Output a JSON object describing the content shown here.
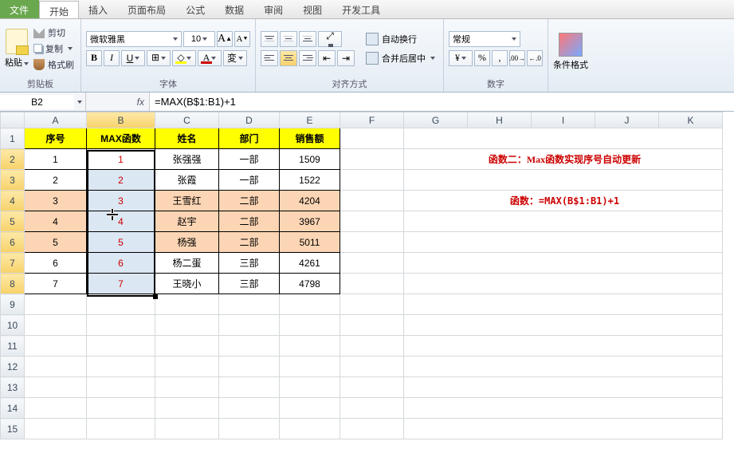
{
  "tabs": {
    "file": "文件",
    "home": "开始",
    "insert": "插入",
    "layout": "页面布局",
    "formulas": "公式",
    "data": "数据",
    "review": "审阅",
    "view": "视图",
    "dev": "开发工具"
  },
  "ribbon": {
    "clipboard": {
      "label": "剪贴板",
      "paste": "粘贴",
      "cut": "剪切",
      "copy": "复制",
      "brush": "格式刷"
    },
    "font": {
      "label": "字体",
      "name": "微软雅黑",
      "size": "10",
      "bold": "B",
      "italic": "I",
      "underline": "U",
      "a_big": "A",
      "a_small": "A"
    },
    "align": {
      "label": "对齐方式",
      "wrap": "自动换行",
      "merge": "合并后居中"
    },
    "number": {
      "label": "数字",
      "format": "常规"
    },
    "style": {
      "label": "条件格式"
    }
  },
  "fbar": {
    "name": "B2",
    "fx": "fx",
    "formula": "=MAX(B$1:B1)+1"
  },
  "cols": [
    "A",
    "B",
    "C",
    "D",
    "E",
    "F",
    "G",
    "H",
    "I",
    "J",
    "K"
  ],
  "headers": {
    "a": "序号",
    "b": "MAX函数",
    "c": "姓名",
    "d": "部门",
    "e": "销售额"
  },
  "rows": [
    {
      "a": "1",
      "b": "1",
      "c": "张强强",
      "d": "一部",
      "e": "1509"
    },
    {
      "a": "2",
      "b": "2",
      "c": "张霞",
      "d": "一部",
      "e": "1522"
    },
    {
      "a": "3",
      "b": "3",
      "c": "王雪红",
      "d": "二部",
      "e": "4204"
    },
    {
      "a": "4",
      "b": "4",
      "c": "赵宇",
      "d": "二部",
      "e": "3967"
    },
    {
      "a": "5",
      "b": "5",
      "c": "杨强",
      "d": "二部",
      "e": "5011"
    },
    {
      "a": "6",
      "b": "6",
      "c": "杨二蛋",
      "d": "三部",
      "e": "4261"
    },
    {
      "a": "7",
      "b": "7",
      "c": "王晓小",
      "d": "三部",
      "e": "4798"
    }
  ],
  "notes": {
    "line1": "函数二：Max函数实现序号自动更新",
    "line2": "函数：=MAX(B$1:B1)+1"
  },
  "chart_data": {
    "type": "table",
    "title": "MAX函数实现序号自动更新",
    "columns": [
      "序号",
      "MAX函数",
      "姓名",
      "部门",
      "销售额"
    ],
    "records": [
      [
        1,
        1,
        "张强强",
        "一部",
        1509
      ],
      [
        2,
        2,
        "张霞",
        "一部",
        1522
      ],
      [
        3,
        3,
        "王雪红",
        "二部",
        4204
      ],
      [
        4,
        4,
        "赵宇",
        "二部",
        3967
      ],
      [
        5,
        5,
        "杨强",
        "二部",
        5011
      ],
      [
        6,
        6,
        "杨二蛋",
        "三部",
        4261
      ],
      [
        7,
        7,
        "王晓小",
        "三部",
        4798
      ]
    ],
    "formula": "=MAX(B$1:B1)+1"
  }
}
